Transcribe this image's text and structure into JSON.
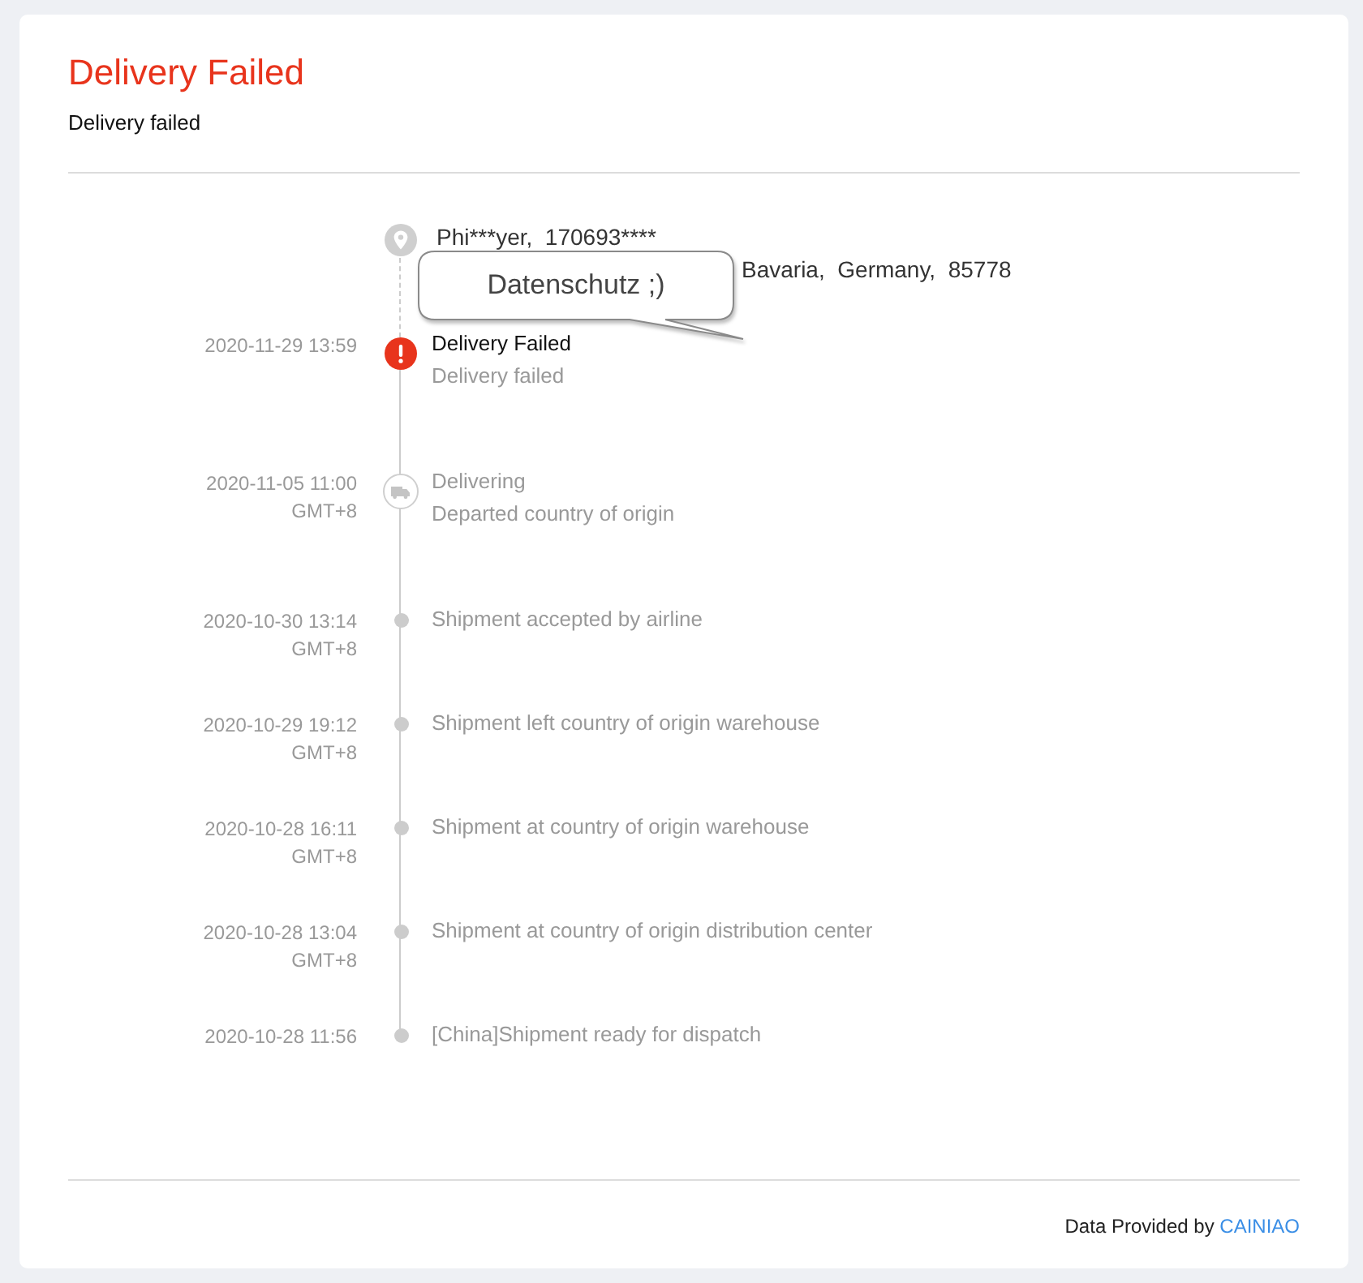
{
  "header": {
    "title": "Delivery Failed",
    "subtitle": "Delivery failed"
  },
  "address": {
    "line_1": "Phi***yer,  170693****",
    "line_2": "Bavaria,  Germany,  85778"
  },
  "annotation": {
    "text": "Datenschutz ;)"
  },
  "events": [
    {
      "kind": "failed",
      "active": true,
      "time": "2020-11-29 13:59",
      "title": "Delivery Failed",
      "description": "Delivery failed"
    },
    {
      "kind": "transit",
      "active": false,
      "time": "2020-11-05 11:00",
      "timezone": "GMT+8",
      "title": "Delivering",
      "description": "Departed country of origin"
    },
    {
      "kind": "dot",
      "active": false,
      "time": "2020-10-30 13:14",
      "timezone": "GMT+8",
      "description": "Shipment accepted by airline"
    },
    {
      "kind": "dot",
      "active": false,
      "time": "2020-10-29 19:12",
      "timezone": "GMT+8",
      "description": "Shipment left country of origin warehouse"
    },
    {
      "kind": "dot",
      "active": false,
      "time": "2020-10-28 16:11",
      "timezone": "GMT+8",
      "description": "Shipment at country of origin warehouse"
    },
    {
      "kind": "dot",
      "active": false,
      "time": "2020-10-28 13:04",
      "timezone": "GMT+8",
      "description": "Shipment at country of origin distribution center"
    },
    {
      "kind": "dot",
      "active": false,
      "time": "2020-10-28 11:56",
      "description": "[China]Shipment ready for dispatch"
    }
  ],
  "footer": {
    "text": "Data Provided by",
    "link": "CAINIAO"
  }
}
